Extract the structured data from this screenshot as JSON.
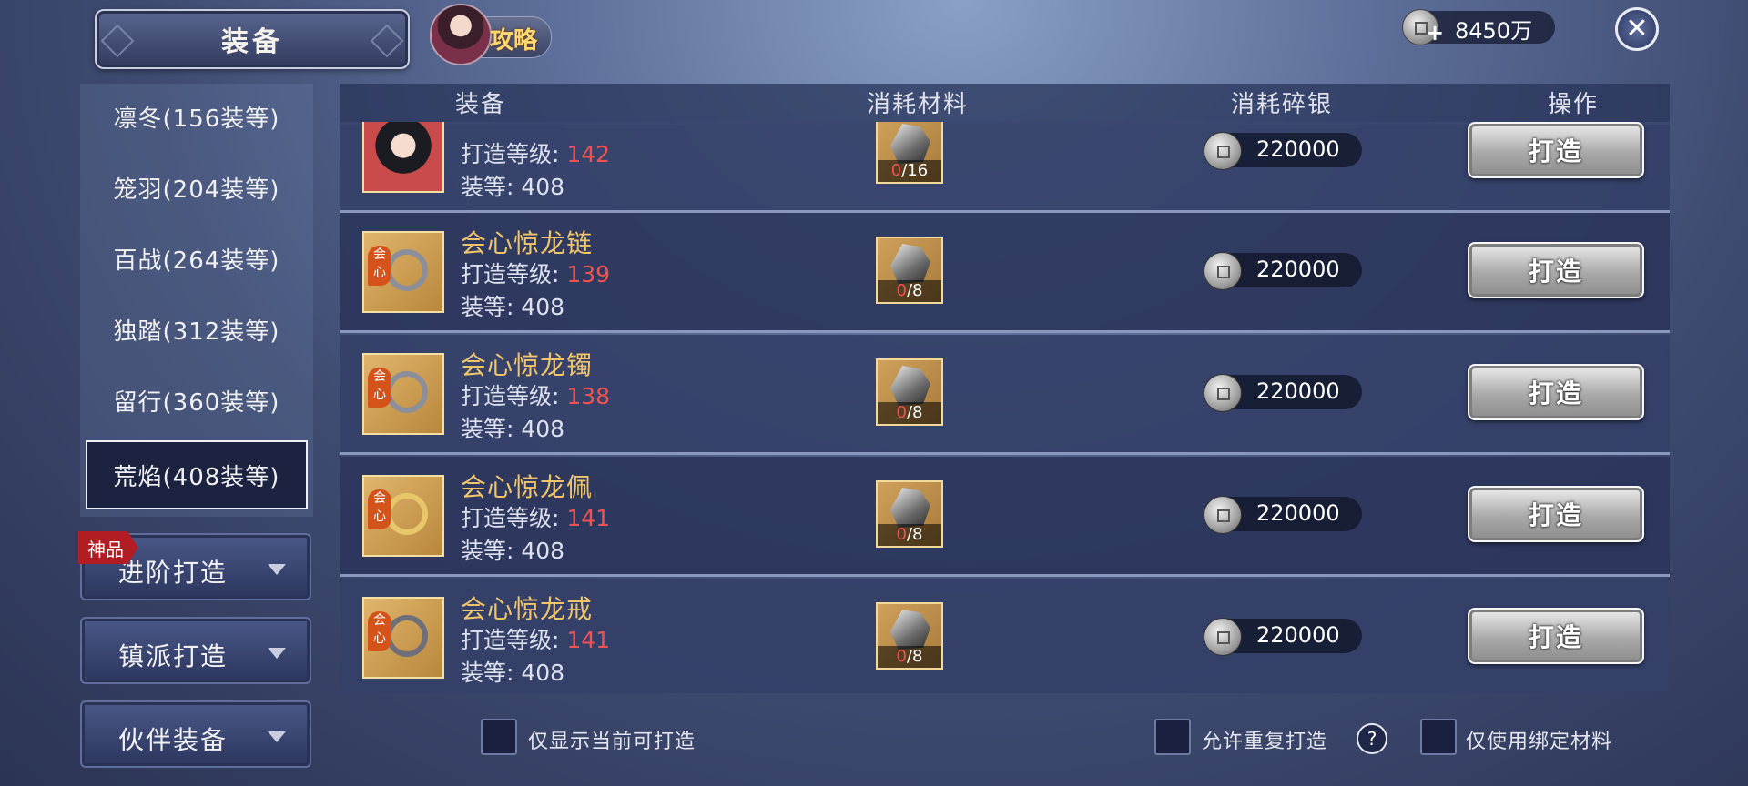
{
  "header": {
    "title": "装备",
    "guide_label": "攻略",
    "currency_value": "8450万",
    "currency_plus": "+",
    "close_glyph": "✕"
  },
  "tiers": [
    {
      "label": "凛冬(156装等)",
      "selected": false
    },
    {
      "label": "笼羽(204装等)",
      "selected": false
    },
    {
      "label": "百战(264装等)",
      "selected": false
    },
    {
      "label": "独踏(312装等)",
      "selected": false
    },
    {
      "label": "留行(360装等)",
      "selected": false
    },
    {
      "label": "荒焰(408装等)",
      "selected": true
    }
  ],
  "side_buttons": [
    {
      "label": "进阶打造",
      "badge": "神品"
    },
    {
      "label": "镇派打造"
    },
    {
      "label": "伙伴装备"
    }
  ],
  "columns": [
    "装备",
    "消耗材料",
    "消耗碎银",
    "操作"
  ],
  "rows": [
    {
      "name": "",
      "level_label": "打造等级: ",
      "level": "142",
      "gear_label": "装等: 408",
      "mat_have": "0",
      "mat_need": "/16",
      "cost": "220000",
      "action": "打造",
      "icon": "portrait-icon"
    },
    {
      "name": "会心惊龙链",
      "level_label": "打造等级: ",
      "level": "139",
      "gear_label": "装等: 408",
      "mat_have": "0",
      "mat_need": "/8",
      "cost": "220000",
      "action": "打造",
      "icon": "necklace-icon",
      "tag": "会心"
    },
    {
      "name": "会心惊龙镯",
      "level_label": "打造等级: ",
      "level": "138",
      "gear_label": "装等: 408",
      "mat_have": "0",
      "mat_need": "/8",
      "cost": "220000",
      "action": "打造",
      "icon": "bracelet-icon",
      "tag": "会心"
    },
    {
      "name": "会心惊龙佩",
      "level_label": "打造等级: ",
      "level": "141",
      "gear_label": "装等: 408",
      "mat_have": "0",
      "mat_need": "/8",
      "cost": "220000",
      "action": "打造",
      "icon": "pendant-icon",
      "tag": "会心"
    },
    {
      "name": "会心惊龙戒",
      "level_label": "打造等级: ",
      "level": "141",
      "gear_label": "装等: 408",
      "mat_have": "0",
      "mat_need": "/8",
      "cost": "220000",
      "action": "打造",
      "icon": "ring-icon",
      "tag": "会心"
    }
  ],
  "footer": {
    "only_craftable": "仅显示当前可打造",
    "allow_repeat": "允许重复打造",
    "help_glyph": "?",
    "only_bound": "仅使用绑定材料"
  },
  "colors": {
    "accent_gold": "#f1c56a",
    "level_red": "#f05252",
    "panel": "#2c365e"
  }
}
